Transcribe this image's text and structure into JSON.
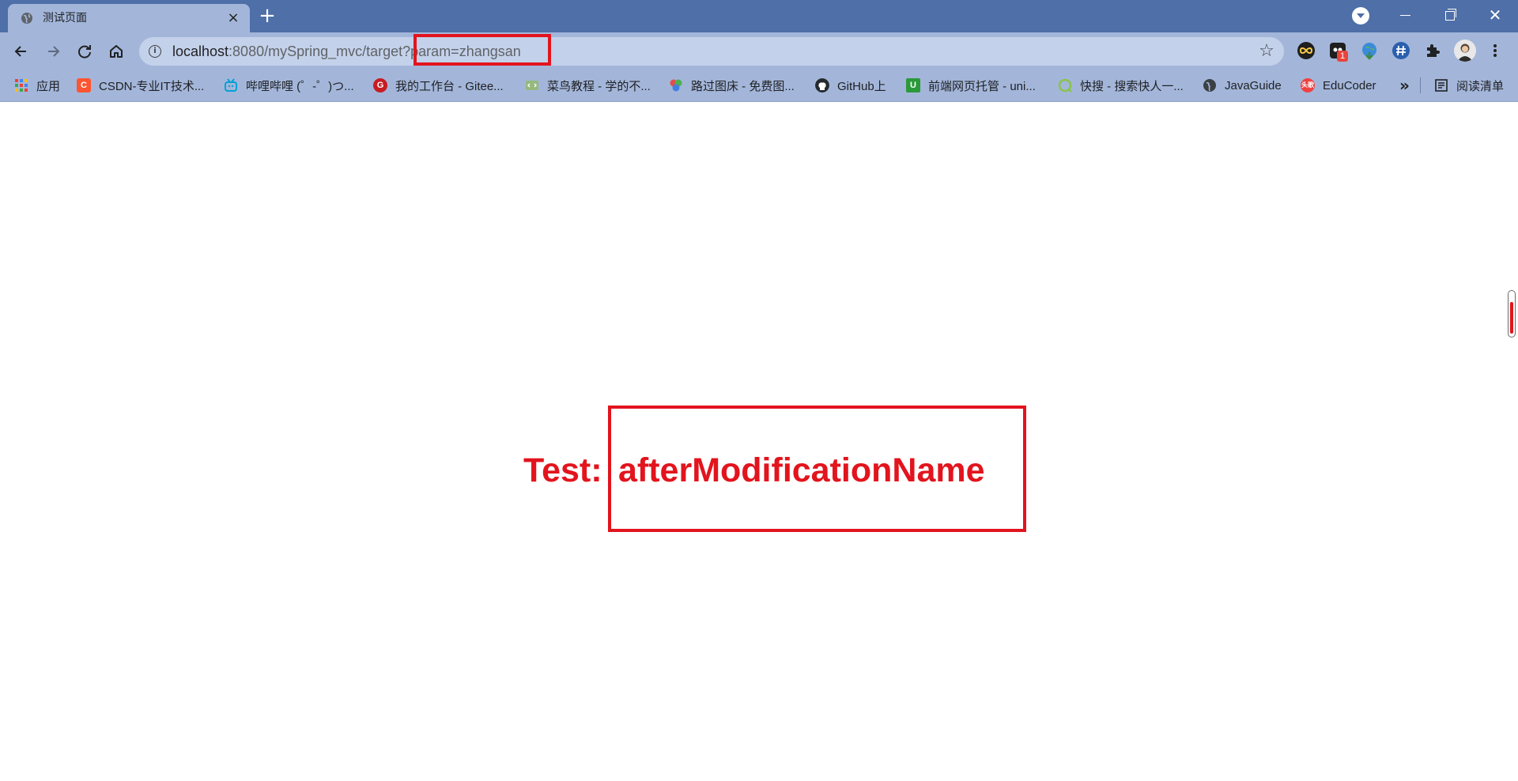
{
  "tab": {
    "title": "测试页面",
    "close": "×"
  },
  "new_tab": "+",
  "window_controls": {
    "close": "✕"
  },
  "address": {
    "host": "localhost",
    "rest": ":8080/mySpring_mvc/target?param=zhangsan",
    "info": "i",
    "star": "☆"
  },
  "bookmarks": [
    {
      "label": "应用",
      "icon": "apps-grid-icon",
      "color": "#4285f4"
    },
    {
      "label": "CSDN-专业IT技术...",
      "icon": "csdn-icon",
      "color": "#fc5531",
      "glyph": "C"
    },
    {
      "label": "哔哩哔哩 (゜-゜)つ...",
      "icon": "bilibili-icon",
      "color": "#00a1d6"
    },
    {
      "label": "我的工作台 - Gitee...",
      "icon": "gitee-icon",
      "color": "#c71d23",
      "glyph": "G"
    },
    {
      "label": "菜鸟教程 - 学的不...",
      "icon": "runoob-icon",
      "color": "#96b97d"
    },
    {
      "label": "路过图床 - 免费图...",
      "icon": "imgur-flower-icon",
      "color": "#e64a4a"
    },
    {
      "label": "GitHub上",
      "icon": "github-icon",
      "color": "#24292e"
    },
    {
      "label": "前端网页托管 - uni...",
      "icon": "uni-icon",
      "color": "#2b9939",
      "glyph": "U"
    },
    {
      "label": "快搜 - 搜索快人一...",
      "icon": "kuaisou-icon",
      "color": "#8bc34a"
    },
    {
      "label": "JavaGuide",
      "icon": "globe-icon",
      "color": "#3c4043"
    },
    {
      "label": "EduCoder",
      "icon": "toutiao-icon",
      "color": "#f04142",
      "glyph": "头歌"
    }
  ],
  "bookmarks_more": "»",
  "reading_list": {
    "label": "阅读清单",
    "icon": "reading-list-icon"
  },
  "extensions": [
    {
      "icon": "infinity-extension-icon"
    },
    {
      "icon": "ghost-extension-icon",
      "badge": "1"
    },
    {
      "icon": "globe-download-extension-icon"
    },
    {
      "icon": "hash-extension-icon"
    },
    {
      "icon": "puzzle-extensions-icon"
    }
  ],
  "page": {
    "label": "Test:",
    "value": "afterModificationName"
  },
  "colors": {
    "tabstrip": "#4e6fa8",
    "toolbar": "#a3b6da",
    "highlight": "#e2141d"
  }
}
